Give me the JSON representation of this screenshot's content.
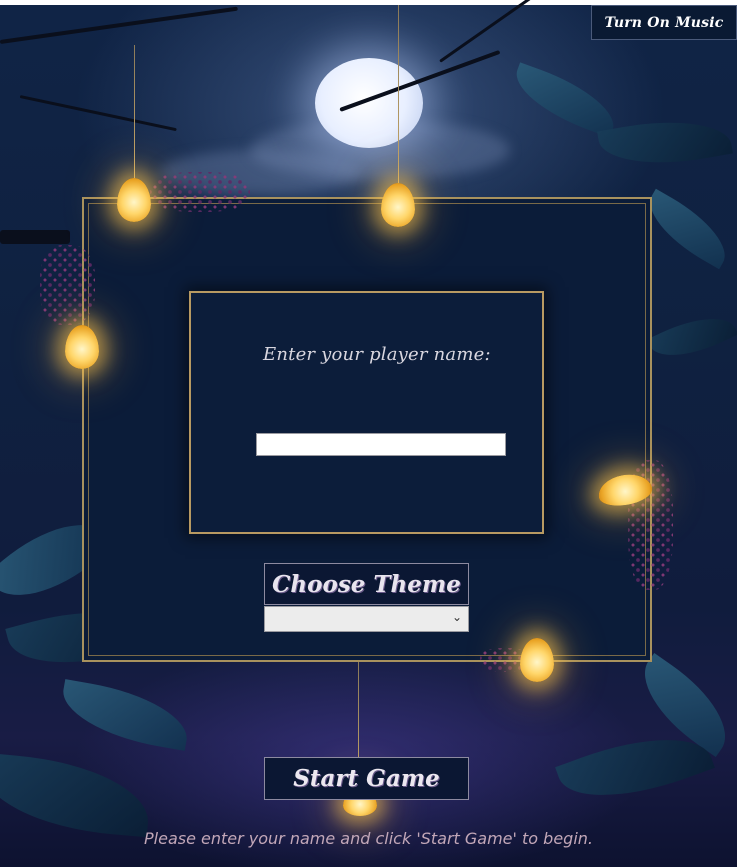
{
  "game": {
    "music_button_label": "Turn On Music",
    "name_prompt": "Enter your player name:",
    "name_input_value": "",
    "theme_label": "Choose Theme",
    "theme_selected": "",
    "start_button_label": "Start Game",
    "hint": "Please enter your name and click 'Start Game' to begin."
  },
  "icons": {
    "select_chevron": "chevron-down-icon",
    "lanterns": "lantern-icon"
  },
  "colors": {
    "frame_gold": "#a8925e",
    "panel_bg": "#0c1d3a",
    "lantern_glow": "#ffd66a"
  }
}
